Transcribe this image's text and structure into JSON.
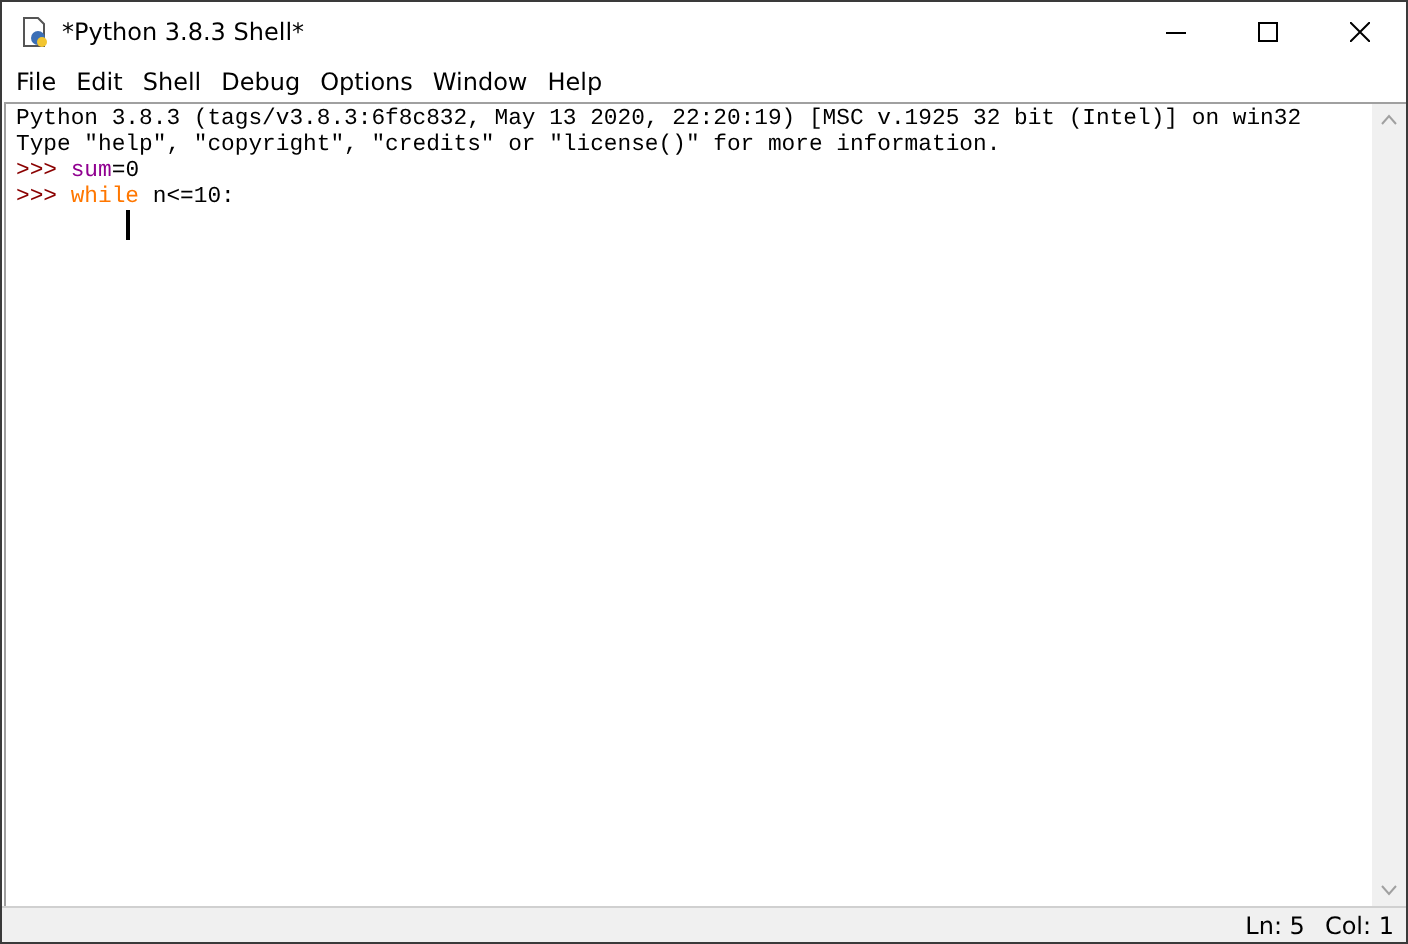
{
  "window": {
    "title": "*Python 3.8.3 Shell*"
  },
  "menu": [
    "File",
    "Edit",
    "Shell",
    "Debug",
    "Options",
    "Window",
    "Help"
  ],
  "editor": {
    "lines": [
      {
        "cursor": false,
        "segments": [
          {
            "kind": "output",
            "text": "Python 3.8.3 (tags/v3.8.3:6f8c832, May 13 2020, 22:20:19) [MSC v.1925 32 bit (Intel)] on win32"
          }
        ]
      },
      {
        "cursor": false,
        "segments": [
          {
            "kind": "output",
            "text": "Type \"help\", \"copyright\", \"credits\" or \"license()\" for more information."
          }
        ]
      },
      {
        "cursor": false,
        "segments": [
          {
            "kind": "prompt",
            "text": ">>> "
          },
          {
            "kind": "builtin",
            "text": "sum"
          },
          {
            "kind": "code",
            "text": "=0"
          }
        ]
      },
      {
        "cursor": false,
        "segments": [
          {
            "kind": "prompt",
            "text": ">>> "
          },
          {
            "kind": "keyword",
            "text": "while"
          },
          {
            "kind": "code",
            "text": " n<=10:"
          }
        ]
      },
      {
        "cursor": true
      }
    ]
  },
  "status_bar": {
    "line": "Ln: 5",
    "column": "Col: 1"
  }
}
